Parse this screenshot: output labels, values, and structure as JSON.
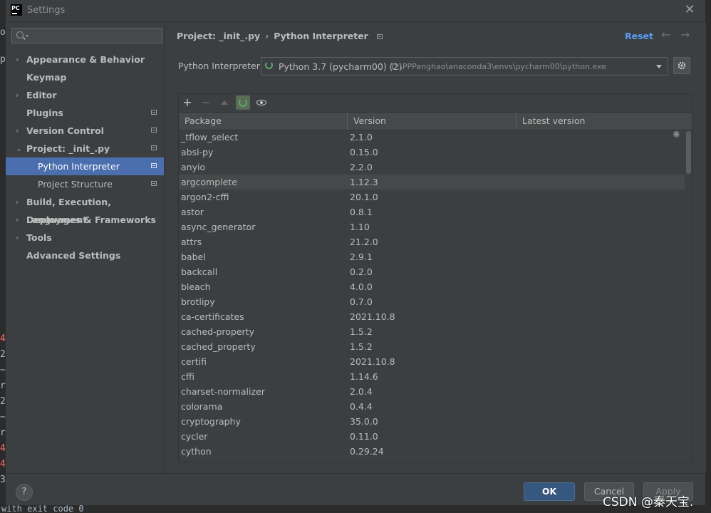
{
  "window": {
    "title": "Settings",
    "app_icon_text": "PC"
  },
  "sidebar": {
    "search": {
      "value": "",
      "placeholder": ""
    },
    "items": [
      {
        "label": "Appearance & Behavior",
        "arrow": "›"
      },
      {
        "label": "Keymap",
        "arrow": ""
      },
      {
        "label": "Editor",
        "arrow": "›"
      },
      {
        "label": "Plugins",
        "arrow": ""
      },
      {
        "label": "Version Control",
        "arrow": "›"
      },
      {
        "label": "Project: _init_.py",
        "arrow": "⌄"
      },
      {
        "label": "Python Interpreter",
        "arrow": ""
      },
      {
        "label": "Project Structure",
        "arrow": ""
      },
      {
        "label": "Build, Execution, Deployment",
        "arrow": "›"
      },
      {
        "label": "Languages & Frameworks",
        "arrow": "›"
      },
      {
        "label": "Tools",
        "arrow": "›"
      },
      {
        "label": "Advanced Settings",
        "arrow": ""
      }
    ]
  },
  "breadcrumb": {
    "project": "Project: _init_.py",
    "separator": "›",
    "page": "Python Interpreter"
  },
  "header": {
    "reset_label": "Reset",
    "back": "←",
    "forward": "→"
  },
  "interpreter": {
    "label": "Python Interpreter:",
    "name": "Python 3.7 (pycharm00) (2)",
    "path": "D:\\PPPanghao\\anaconda3\\envs\\pycharm00\\python.exe"
  },
  "toolbar": {
    "add": "+",
    "remove": "−"
  },
  "table": {
    "columns": [
      "Package",
      "Version",
      "Latest version"
    ],
    "rows": [
      [
        "_tflow_select",
        "2.1.0"
      ],
      [
        "absl-py",
        "0.15.0"
      ],
      [
        "anyio",
        "2.2.0"
      ],
      [
        "argcomplete",
        "1.12.3"
      ],
      [
        "argon2-cffi",
        "20.1.0"
      ],
      [
        "astor",
        "0.8.1"
      ],
      [
        "async_generator",
        "1.10"
      ],
      [
        "attrs",
        "21.2.0"
      ],
      [
        "babel",
        "2.9.1"
      ],
      [
        "backcall",
        "0.2.0"
      ],
      [
        "bleach",
        "4.0.0"
      ],
      [
        "brotlipy",
        "0.7.0"
      ],
      [
        "ca-certificates",
        "2021.10.8"
      ],
      [
        "cached-property",
        "1.5.2"
      ],
      [
        "cached_property",
        "1.5.2"
      ],
      [
        "certifi",
        "2021.10.8"
      ],
      [
        "cffi",
        "1.14.6"
      ],
      [
        "charset-normalizer",
        "2.0.4"
      ],
      [
        "colorama",
        "0.4.4"
      ],
      [
        "cryptography",
        "35.0.0"
      ],
      [
        "cycler",
        "0.11.0"
      ],
      [
        "cython",
        "0.29.24"
      ]
    ]
  },
  "footer": {
    "help": "?",
    "ok": "OK",
    "cancel": "Cancel",
    "apply": "Apply"
  },
  "background": {
    "edge_chars": [
      "or",
      "p",
      "4",
      "2",
      "~",
      "r",
      "2",
      "~",
      "r",
      "4",
      "4",
      "3"
    ],
    "console_text": "with exit code 0"
  },
  "watermark": "CSDN @秦天宝.",
  "colors": {
    "selection": "#4b6eaf",
    "link": "#589df6",
    "ok_button": "#365880",
    "spinner": "#59a869"
  }
}
